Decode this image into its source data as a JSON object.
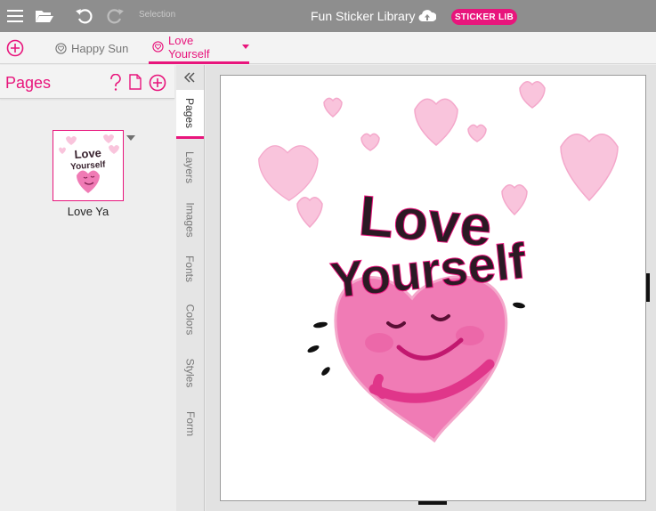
{
  "app": {
    "title": "Fun Sticker Library",
    "badge": "STICKER LIB",
    "selection_label": "Selection"
  },
  "toolbar": {
    "icons": [
      "menu-icon",
      "folder-open-icon",
      "undo-icon",
      "redo-icon",
      "cloud-upload-icon"
    ]
  },
  "tabs": [
    {
      "label": "Happy Sun",
      "active": false
    },
    {
      "label": "Love Yourself",
      "active": true
    }
  ],
  "panel": {
    "title": "Pages",
    "pages": [
      {
        "label": "Love Ya",
        "thumb_text": "Love Yourself"
      }
    ]
  },
  "side_tabs": [
    "Pages",
    "Layers",
    "Images",
    "Fonts",
    "Colors",
    "Styles",
    "Form"
  ],
  "artwork": {
    "line1": "Love",
    "line2": "Yourself"
  },
  "colors": {
    "accent": "#e8157c",
    "topbar": "#8e8e8e",
    "heart_pink": "#f07bb5",
    "light_heart": "#f9c4dc"
  }
}
